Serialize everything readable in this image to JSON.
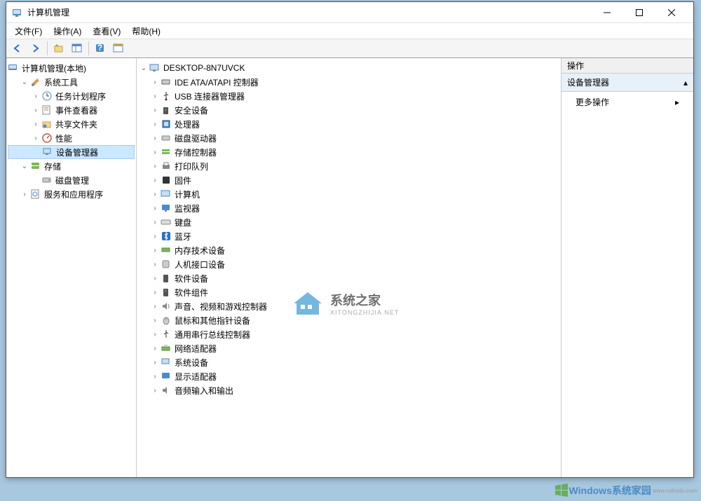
{
  "titlebar": {
    "title": "计算机管理"
  },
  "menubar": {
    "file": "文件(F)",
    "action": "操作(A)",
    "view": "查看(V)",
    "help": "帮助(H)"
  },
  "leftTree": {
    "root": "计算机管理(本地)",
    "systemTools": "系统工具",
    "taskScheduler": "任务计划程序",
    "eventViewer": "事件查看器",
    "sharedFolders": "共享文件夹",
    "performance": "性能",
    "deviceManager": "设备管理器",
    "storage": "存储",
    "diskManagement": "磁盘管理",
    "services": "服务和应用程序"
  },
  "centerTree": {
    "root": "DESKTOP-8N7UVCK",
    "ide": "IDE ATA/ATAPI 控制器",
    "usb": "USB 连接器管理器",
    "security": "安全设备",
    "cpu": "处理器",
    "diskDrive": "磁盘驱动器",
    "storageCtrl": "存储控制器",
    "printQueue": "打印队列",
    "firmware": "固件",
    "computer": "计算机",
    "monitor": "监视器",
    "keyboard": "键盘",
    "bluetooth": "蓝牙",
    "memory": "内存技术设备",
    "hid": "人机接口设备",
    "software": "软件设备",
    "softwareComp": "软件组件",
    "sound": "声音、视频和游戏控制器",
    "mouse": "鼠标和其他指针设备",
    "usbCtrl": "通用串行总线控制器",
    "network": "网络适配器",
    "systemDev": "系统设备",
    "display": "显示适配器",
    "audio": "音频输入和输出"
  },
  "actions": {
    "header": "操作",
    "section": "设备管理器",
    "more": "更多操作"
  },
  "watermark": {
    "title": "系统之家",
    "sub": "XITONGZHIJIA.NET"
  },
  "bottomLogo": {
    "text": "Windows系统家园",
    "sub": "www.ruihudu.com"
  }
}
